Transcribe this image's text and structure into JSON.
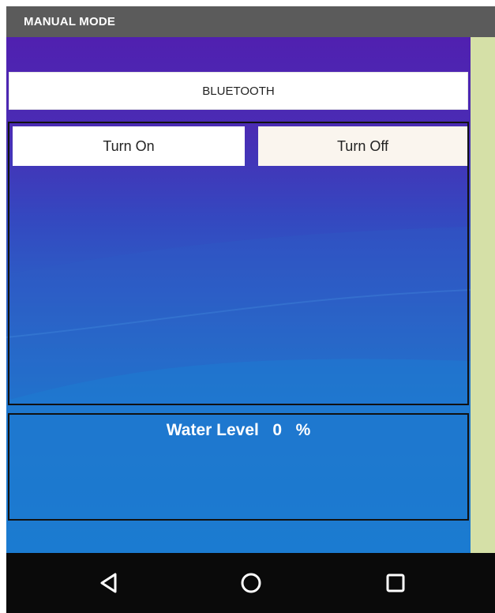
{
  "window": {
    "title": "MANUAL MODE"
  },
  "controls": {
    "bluetooth_label": "BLUETOOTH",
    "turn_on_label": "Turn On",
    "turn_off_label": "Turn Off"
  },
  "water_level": {
    "label": "Water Level",
    "value": "0",
    "unit": "%"
  },
  "navbar": {
    "icons": [
      "back-icon",
      "home-icon",
      "recent-apps-icon"
    ]
  },
  "colors": {
    "titlebar": "#5b5b5b",
    "screen_top": "#5020b0",
    "screen_bottom": "#1188d4",
    "right_strip": "#d5e0a7",
    "navbar": "#0a0a0a"
  }
}
